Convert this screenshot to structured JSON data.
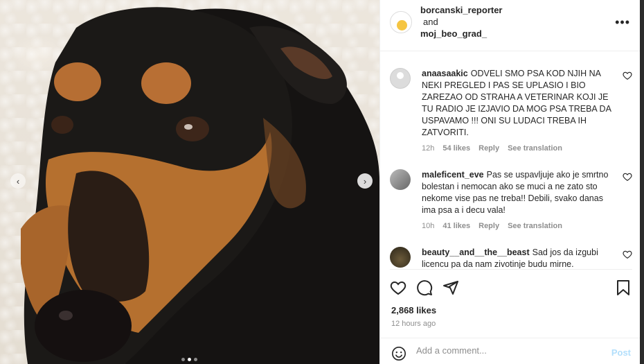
{
  "post": {
    "author_primary": "borcanski_reporter",
    "connector": "and",
    "author_secondary": "moj_beo_grad_",
    "more_icon": "more-horizontal-icon",
    "likes": "2,868 likes",
    "posted": "12 hours ago"
  },
  "comments": [
    {
      "username": "anaasaakic",
      "text": "ODVELI SMO PSA KOD NJIH NA NEKI PREGLED I PAS SE UPLASIO I BIO ZAREZAO OD STRAHA A VETERINAR KOJI JE TU RADIO JE IZJAVIO DA MOG PSA TREBA DA USPAVAMO !!! ONI SU LUDACI TREBA IH ZATVORITI.",
      "age": "12h",
      "likes": "54 likes",
      "reply": "Reply",
      "translate": "See translation"
    },
    {
      "username": "maleficent_eve",
      "text": "Pas se uspavljuje ako je smrtno bolestan i nemocan ako se muci a ne zato sto nekome vise pas ne treba!! Debili, svako danas ima psa a i decu vala!",
      "age": "10h",
      "likes": "41 likes",
      "reply": "Reply",
      "translate": "See translation"
    },
    {
      "username": "beauty__and__the__beast",
      "text": "Sad jos da izgubi licencu pa da nam zivotinje budu mirne."
    }
  ],
  "composer": {
    "placeholder": "Add a comment...",
    "post_label": "Post"
  },
  "colors": {
    "link_disabled": "#b2dffc",
    "secondary_text": "#8e8e8e",
    "primary_text": "#262626"
  }
}
